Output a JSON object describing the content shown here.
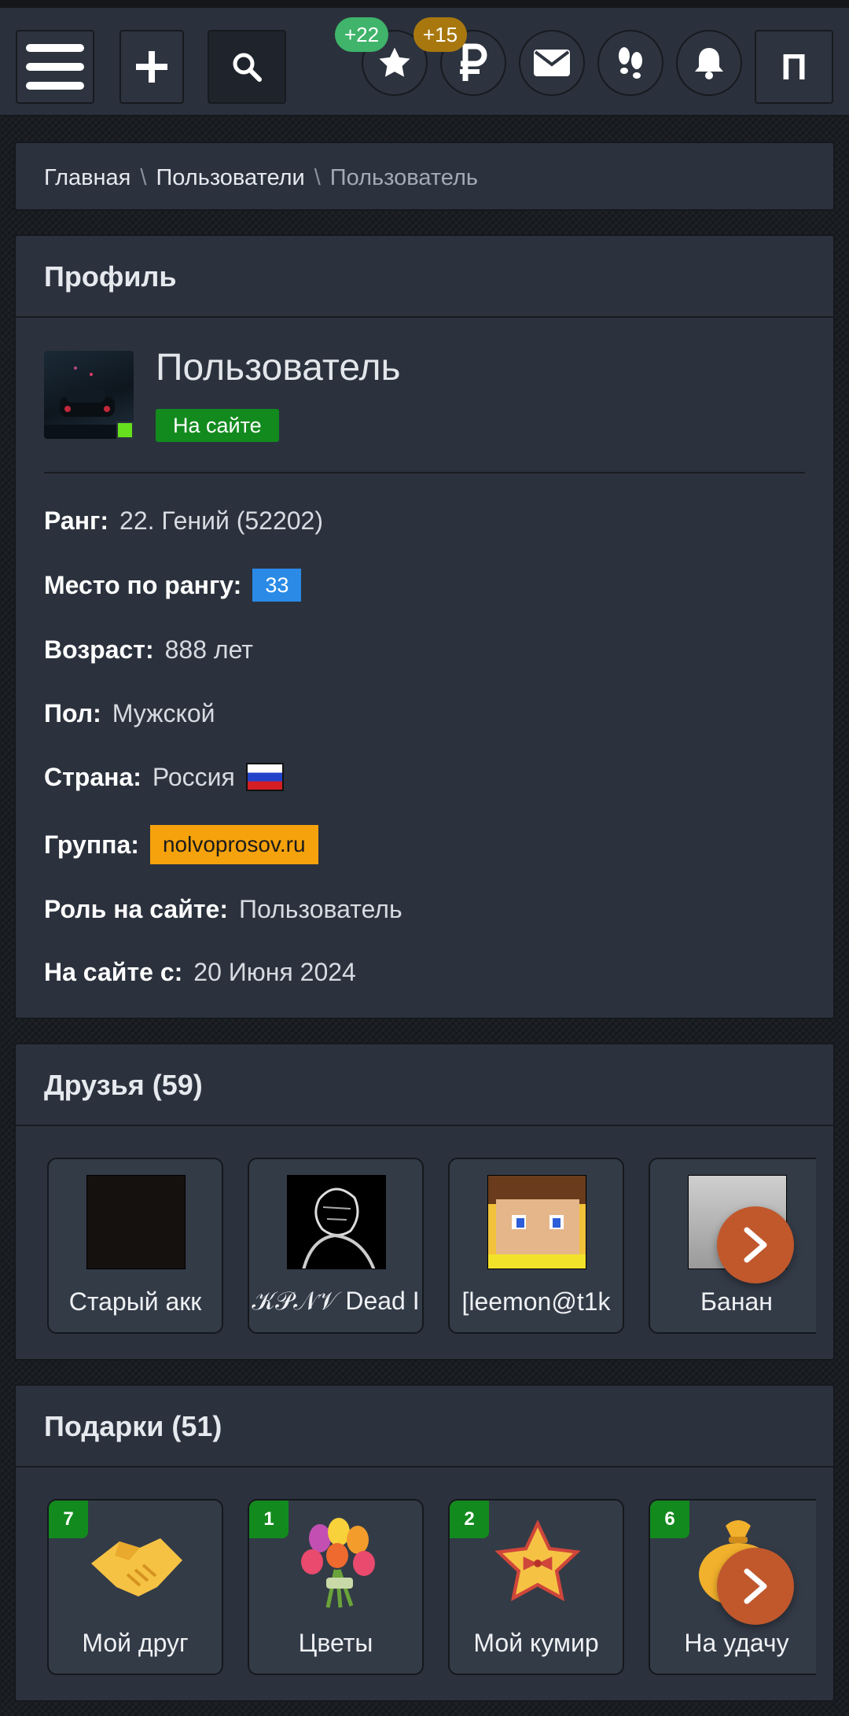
{
  "header": {
    "star_badge": "+22",
    "coin_badge": "+15",
    "profile_button_label": "П",
    "colors": {
      "star_badge": "#3fb46a",
      "coin_badge": "#a8780f"
    }
  },
  "breadcrumb": {
    "home": "Главная",
    "users": "Пользователи",
    "current": "Пользователь",
    "separator": "\\"
  },
  "profile": {
    "title": "Профиль",
    "username": "Пользователь",
    "status": "На сайте",
    "fields": {
      "rank_label": "Ранг:",
      "rank_value": "22. Гений (52202)",
      "place_label": "Место по рангу:",
      "place_value": "33",
      "age_label": "Возраст:",
      "age_value": "888 лет",
      "gender_label": "Пол:",
      "gender_value": "Мужской",
      "country_label": "Страна:",
      "country_value": "Россия",
      "group_label": "Группа:",
      "group_value": "nolvoprosov.ru",
      "role_label": "Роль на сайте:",
      "role_value": "Пользователь",
      "since_label": "На сайте с:",
      "since_value": "20 Июня 2024"
    }
  },
  "friends": {
    "title": "Друзья (59)",
    "items": [
      {
        "name": "Старый акк"
      },
      {
        "name": "𝒦𝒫𝒩𝒱 Dead I"
      },
      {
        "name": "[leemon@t1k"
      },
      {
        "name": "Банан"
      }
    ]
  },
  "gifts": {
    "title": "Подарки (51)",
    "items": [
      {
        "name": "Мой друг",
        "count": "7",
        "icon": "handshake-icon"
      },
      {
        "name": "Цветы",
        "count": "1",
        "icon": "flowers-icon"
      },
      {
        "name": "Мой кумир",
        "count": "2",
        "icon": "star-bow-icon"
      },
      {
        "name": "На удачу",
        "count": "6",
        "icon": "money-bag-icon"
      }
    ]
  }
}
